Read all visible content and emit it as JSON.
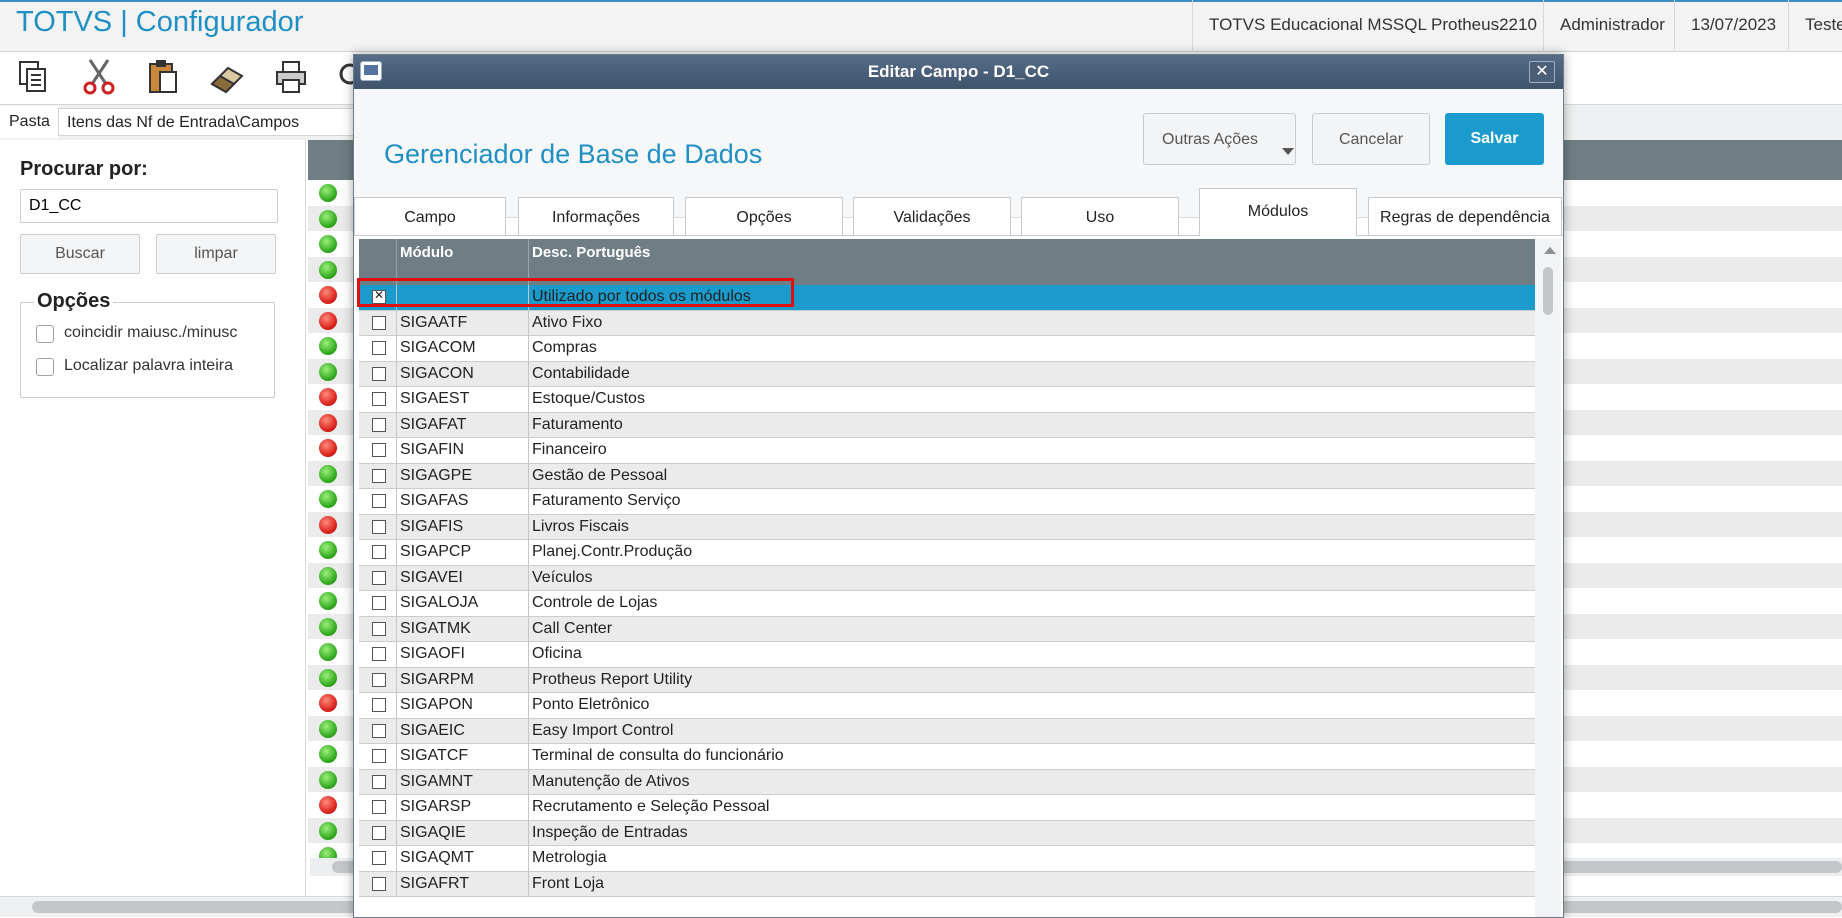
{
  "app": {
    "title": "TOTVS | Configurador",
    "environment": "TOTVS Educacional MSSQL Protheus2210",
    "user": "Administrador",
    "date": "13/07/2023",
    "extra": "Teste"
  },
  "folder": {
    "tab_label": "Pasta",
    "path": "Itens das Nf de Entrada\\Campos"
  },
  "search": {
    "label": "Procurar por:",
    "value": "D1_CC",
    "buscar_label": "Buscar",
    "limpar_label": "limpar"
  },
  "options": {
    "title": "Opções",
    "items": [
      {
        "label": "coincidir maiusc./minusc",
        "checked": false
      },
      {
        "label": "Localizar palavra inteira",
        "checked": false
      }
    ]
  },
  "toolbar": {
    "icons": [
      "copy-icon",
      "cut-icon",
      "paste-icon",
      "eraser-icon",
      "print-icon",
      "search-icon"
    ]
  },
  "background_rows": [
    "green",
    "green",
    "green",
    "green",
    "red",
    "red",
    "green",
    "green",
    "red",
    "red",
    "red",
    "green",
    "green",
    "red",
    "green",
    "green",
    "green",
    "green",
    "green",
    "green",
    "red",
    "green",
    "green",
    "green",
    "red",
    "green",
    "green"
  ],
  "dialog": {
    "title": "Editar Campo - D1_CC",
    "heading": "Gerenciador de Base de Dados",
    "buttons": {
      "outras": "Outras Ações",
      "cancelar": "Cancelar",
      "salvar": "Salvar"
    },
    "tabs": [
      {
        "label": "Campo",
        "active": false
      },
      {
        "label": "Informações",
        "active": false
      },
      {
        "label": "Opções",
        "active": false
      },
      {
        "label": "Validações",
        "active": false
      },
      {
        "label": "Uso",
        "active": false
      },
      {
        "label": "Módulos",
        "active": true
      },
      {
        "label": "Regras de dependência",
        "active": false
      }
    ],
    "grid": {
      "columns": [
        "Módulo",
        "Desc. Português"
      ],
      "rows": [
        {
          "code": "",
          "desc": "Utilizado por todos os módulos",
          "checked": true,
          "selected": true
        },
        {
          "code": "SIGAATF",
          "desc": "Ativo Fixo",
          "checked": false
        },
        {
          "code": "SIGACOM",
          "desc": "Compras",
          "checked": false
        },
        {
          "code": "SIGACON",
          "desc": "Contabilidade",
          "checked": false
        },
        {
          "code": "SIGAEST",
          "desc": "Estoque/Custos",
          "checked": false
        },
        {
          "code": "SIGAFAT",
          "desc": "Faturamento",
          "checked": false
        },
        {
          "code": "SIGAFIN",
          "desc": "Financeiro",
          "checked": false
        },
        {
          "code": "SIGAGPE",
          "desc": "Gestão de Pessoal",
          "checked": false
        },
        {
          "code": "SIGAFAS",
          "desc": "Faturamento Serviço",
          "checked": false
        },
        {
          "code": "SIGAFIS",
          "desc": "Livros Fiscais",
          "checked": false
        },
        {
          "code": "SIGAPCP",
          "desc": "Planej.Contr.Produção",
          "checked": false
        },
        {
          "code": "SIGAVEI",
          "desc": "Veículos",
          "checked": false
        },
        {
          "code": "SIGALOJA",
          "desc": "Controle de Lojas",
          "checked": false
        },
        {
          "code": "SIGATMK",
          "desc": "Call Center",
          "checked": false
        },
        {
          "code": "SIGAOFI",
          "desc": "Oficina",
          "checked": false
        },
        {
          "code": "SIGARPM",
          "desc": "Protheus Report Utility",
          "checked": false
        },
        {
          "code": "SIGAPON",
          "desc": "Ponto Eletrônico",
          "checked": false
        },
        {
          "code": "SIGAEIC",
          "desc": "Easy Import Control",
          "checked": false
        },
        {
          "code": "SIGATCF",
          "desc": "Terminal de consulta do funcionário",
          "checked": false
        },
        {
          "code": "SIGAMNT",
          "desc": "Manutenção de Ativos",
          "checked": false
        },
        {
          "code": "SIGARSP",
          "desc": "Recrutamento e Seleção Pessoal",
          "checked": false
        },
        {
          "code": "SIGAQIE",
          "desc": "Inspeção de Entradas",
          "checked": false
        },
        {
          "code": "SIGAQMT",
          "desc": "Metrologia",
          "checked": false
        },
        {
          "code": "SIGAFRT",
          "desc": "Front Loja",
          "checked": false
        }
      ]
    }
  },
  "colors": {
    "accent": "#1f8fc4",
    "save_button": "#1a9bcc",
    "grid_header": "#6f7e84",
    "highlight": "#e01010"
  }
}
